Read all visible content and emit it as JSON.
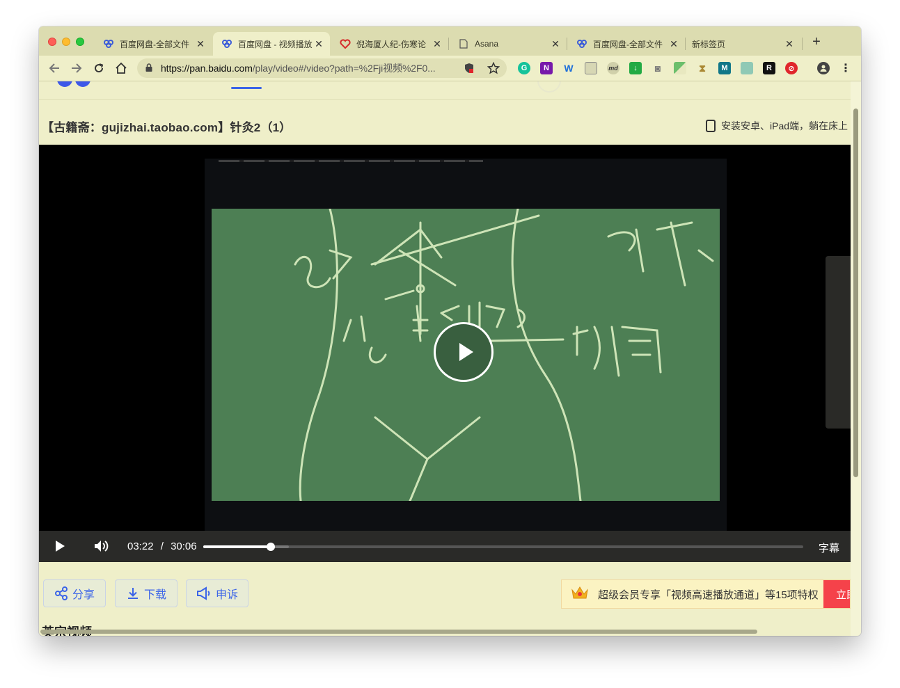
{
  "browser": {
    "tabs": [
      {
        "title": "百度网盘-全部文件",
        "icon": "baidu-pan-icon",
        "active": false
      },
      {
        "title": "百度网盘 - 视频播放",
        "icon": "baidu-pan-icon",
        "active": true
      },
      {
        "title": "倪海厦人纪-伤寒论",
        "icon": "heart-icon",
        "active": false
      },
      {
        "title": "Asana",
        "icon": "page-icon",
        "active": false
      },
      {
        "title": "百度网盘-全部文件",
        "icon": "baidu-pan-icon",
        "active": false
      },
      {
        "title": "新标签页",
        "icon": "",
        "active": false
      }
    ],
    "url_host": "https://pan.baidu.com",
    "url_rest": "/play/video#/video?path=%2Fji视频%2F0...",
    "extensions": [
      {
        "name": "grammarly-icon",
        "label": "G",
        "color": "#15c39a"
      },
      {
        "name": "onenote-icon",
        "label": "N",
        "color": "#7719aa"
      },
      {
        "name": "word-icon",
        "label": "W",
        "color": "#1e6fd9"
      },
      {
        "name": "note-icon",
        "label": "",
        "color": "#c8c8a0"
      },
      {
        "name": "markdown-icon",
        "label": "md",
        "color": "#888866"
      },
      {
        "name": "download-icon",
        "label": "↓",
        "color": "#22aa44"
      },
      {
        "name": "camera-icon",
        "label": "◙",
        "color": "#777"
      },
      {
        "name": "sheet-icon",
        "label": "",
        "color": "#55aa55"
      },
      {
        "name": "hourglass-icon",
        "label": "⧗",
        "color": "#aa8833"
      },
      {
        "name": "m-icon",
        "label": "M",
        "color": "#117788"
      },
      {
        "name": "book-icon",
        "label": "",
        "color": "#66aa99"
      },
      {
        "name": "r-icon",
        "label": "R",
        "color": "#111111"
      },
      {
        "name": "no-tracking-icon",
        "label": "⊘",
        "color": "#e0262c"
      }
    ]
  },
  "page": {
    "video_title": "【古籍斋：gujizhai.taobao.com】针灸2（1）",
    "install_promo": "安装安卓、iPad端，躺在床上"
  },
  "player": {
    "current_time": "03:22",
    "separator": "/",
    "duration": "30:06",
    "progress_fraction": 0.112,
    "buffered_fraction": 0.143,
    "subtitles_label": "字幕"
  },
  "actions": {
    "share": "分享",
    "download": "下载",
    "report": "申诉"
  },
  "vip": {
    "text": "超级会员专享「视频高速播放通道」等15项特权",
    "button": "立即开通"
  },
  "section_peek": "英宗视频"
}
